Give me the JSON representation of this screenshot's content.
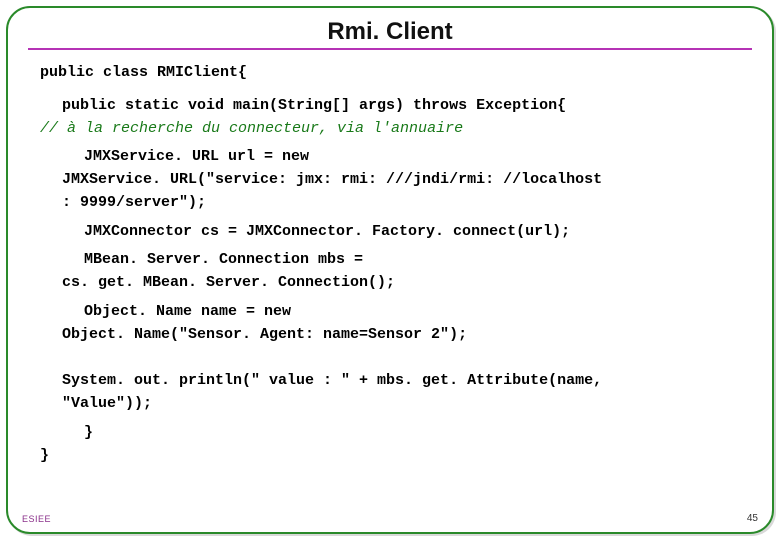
{
  "slide": {
    "title": "Rmi. Client"
  },
  "code": {
    "l1": "public class RMIClient{",
    "l2": "public static void main(String[] args) throws Exception{",
    "l3_comment": "// à la recherche du connecteur, via l'annuaire",
    "l4a": "JMXService. URL url = new",
    "l4b": "JMXService. URL(\"service: jmx: rmi: ///jndi/rmi: //localhost",
    "l4c": ": 9999/server\");",
    "l5": "JMXConnector cs = JMXConnector. Factory. connect(url);",
    "l6a": "MBean. Server. Connection mbs =",
    "l6b": "cs. get. MBean. Server. Connection();",
    "l7a": "Object. Name name = new",
    "l7b": "Object. Name(\"Sensor. Agent: name=Sensor 2\");",
    "l8a": "System. out. println(\" value : \" + mbs. get. Attribute(name,",
    "l8b": "\"Value\"));",
    "l9": "}",
    "l10": "}"
  },
  "footer": {
    "left": "ESIEE",
    "right": "45"
  }
}
